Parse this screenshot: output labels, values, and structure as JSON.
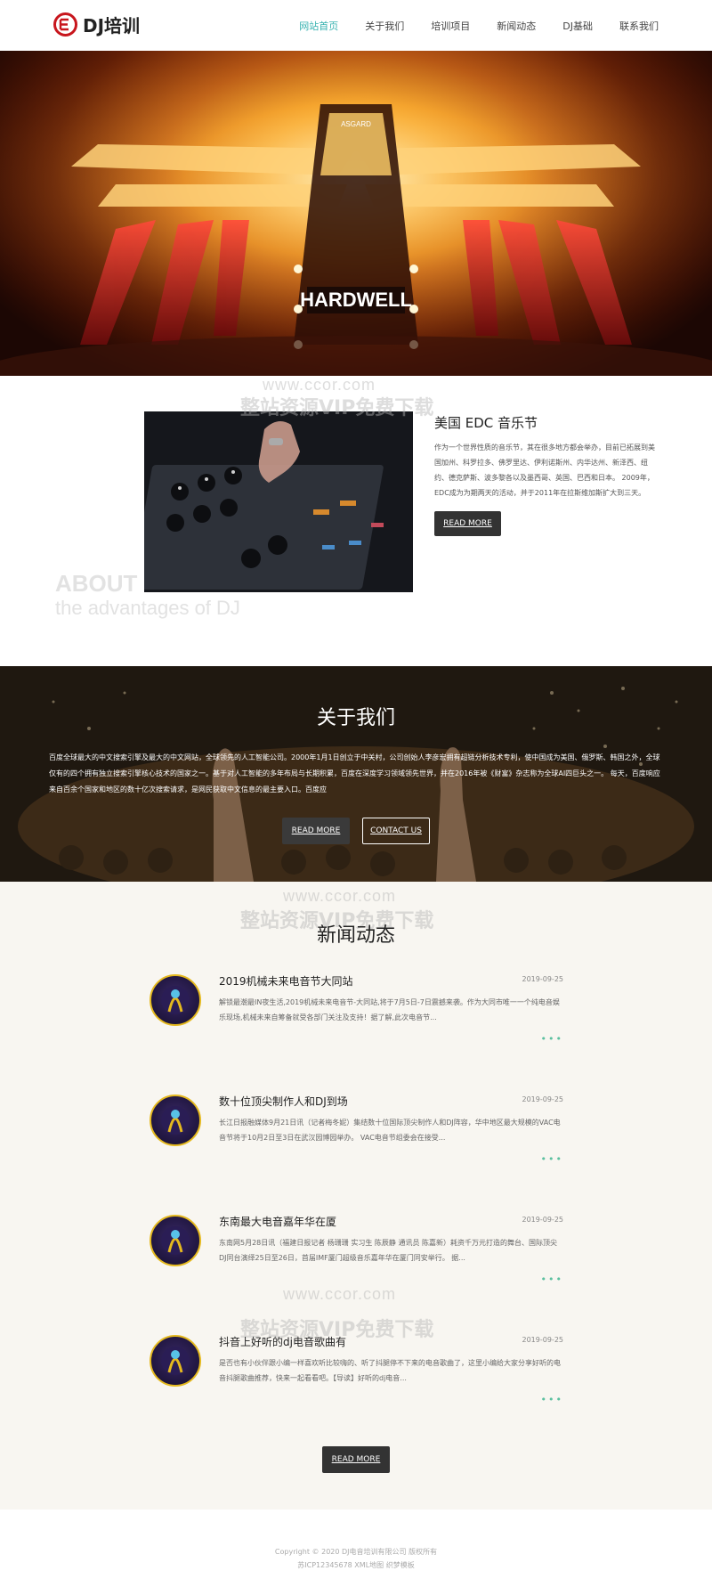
{
  "header": {
    "logo_text": "DJ培训",
    "nav": [
      "网站首页",
      "关于我们",
      "培训项目",
      "新闻动态",
      "DJ基础",
      "联系我们"
    ],
    "active_index": 0,
    "accent_color": "#37b2b0",
    "brand_color": "#c8161d"
  },
  "hero": {
    "stage_text": "HARDWELL",
    "top_badge": "ASGARD"
  },
  "about": {
    "title": "美国 EDC 音乐节",
    "text": "作为一个世界性质的音乐节，其在很多地方都会举办，目前已拓展到美国加州、科罗拉多、佛罗里达、伊利诺斯州、内华达州、新泽西、纽约、德克萨斯、波多黎各以及墨西哥、英国、巴西和日本。 2009年，EDC成为为期两天的活动，并于2011年在拉斯维加斯扩大到三天。",
    "button": "READ MORE",
    "bg_word1": "ABOUT",
    "bg_word2": "the advantages of DJ"
  },
  "watermark": {
    "url": "www.ccor.com",
    "text": "整站资源VIP免费下载"
  },
  "band": {
    "title": "关于我们",
    "text": "百度全球最大的中文搜索引擎及最大的中文网站，全球领先的人工智能公司。2000年1月1日创立于中关村，公司创始人李彦宏拥有超链分析技术专利，使中国成为美国、俄罗斯、韩国之外，全球仅有的四个拥有独立搜索引擎核心技术的国家之一。基于对人工智能的多年布局与长期积累，百度在深度学习领域领先世界，并在2016年被《财富》杂志称为全球AI四巨头之一。 每天，百度响应来自百余个国家和地区的数十亿次搜索请求，是网民获取中文信息的最主要入口。百度应",
    "button1": "READ MORE",
    "button2": "CONTACT US"
  },
  "news": {
    "title": "新闻动态",
    "items": [
      {
        "title": "2019机械未来电音节大同站",
        "date": "2019-09-25",
        "desc": "解锁最潮最IN夜生活,2019机械未来电音节-大同站,将于7月5日-7日震撼来袭。作为大同市唯一一个纯电音娱乐现场,机械未来自筹备就受各部门关注及支持！据了解,此次电音节..."
      },
      {
        "title": "数十位顶尖制作人和DJ到场",
        "date": "2019-09-25",
        "desc": "长江日报融媒体9月21日讯（记者梅冬妮）集结数十位国际顶尖制作人和DJ阵容，华中地区最大规模的VAC电音节将于10月2日至3日在武汉园博园举办。 VAC电音节组委会在接受..."
      },
      {
        "title": "东南最大电音嘉年华在厦",
        "date": "2019-09-25",
        "desc": "东南网5月28日讯（福建日报记者 杨珊珊 实习生 陈辰静 通讯员 陈嘉新）耗资千万元打造的舞台、国际顶尖DJ同台演绎25日至26日，首届IMF厦门超级音乐嘉年华在厦门同安举行。 据..."
      },
      {
        "title": "抖音上好听的dj电音歌曲有",
        "date": "2019-09-25",
        "desc": "是否也有小伙伴跟小编一样喜欢听比较嗨的、听了抖腿停不下来的电音歌曲了，这里小编给大家分享好听的电音抖腿歌曲推荐，快来一起看看吧。【导读】好听的dj电音..."
      }
    ],
    "more_glyph": "•••",
    "button": "READ MORE"
  },
  "footer": {
    "line1": "Copyright © 2020 DJ电音培训有限公司 版权所有",
    "line2": "苏ICP12345678 XML地图 织梦模板"
  }
}
